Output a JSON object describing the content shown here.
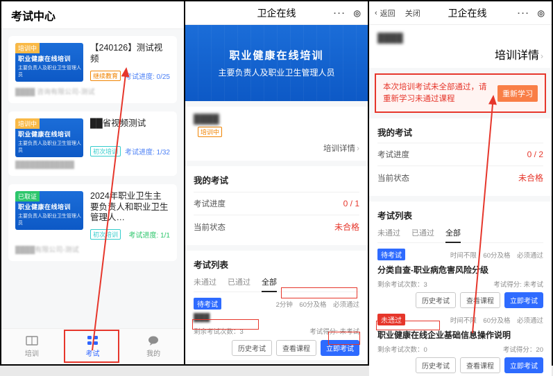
{
  "pane1": {
    "header_title": "考试中心",
    "cards": [
      {
        "badge": "培训中",
        "thumb_line1": "职业健康在线培训",
        "thumb_line2": "主要负责人及职业卫生管理人员",
        "title": "【240126】测试视频",
        "tag": "继续教育",
        "tag_style": "orange",
        "progress_label": "考试进度: 0/25",
        "progress_style": "blue",
        "subtitle": "████ 咨询有限公司-测试"
      },
      {
        "badge": "培训中",
        "thumb_line1": "职业健康在线培训",
        "thumb_line2": "主要负责人及职业卫生管理人员",
        "title": "██省视频测试",
        "tag": "初次培训",
        "tag_style": "teal",
        "progress_label": "考试进度: 1/32",
        "progress_style": "blue",
        "subtitle": "████████████"
      },
      {
        "badge": "已取证",
        "thumb_line1": "职业健康在线培训",
        "thumb_line2": "主要负责人及职业卫生管理人员",
        "title": "2024年职业卫生主要负责人和职业卫生管理人…",
        "tag": "初次培训",
        "tag_style": "teal",
        "progress_label": "考试进度: 1/1",
        "progress_style": "green",
        "subtitle": "████有限公司-测试"
      }
    ],
    "tabs": [
      {
        "label": "培训"
      },
      {
        "label": "考试"
      },
      {
        "label": "我的"
      }
    ]
  },
  "pane2": {
    "title": "卫企在线",
    "banner_t1": "职业健康在线培训",
    "banner_t2": "主要负责人及职业卫生管理人员",
    "org_name": "████",
    "training_status": "培训中",
    "detail_label": "培训详情",
    "myexam_title": "我的考试",
    "progress_label": "考试进度",
    "progress_value": "0 / 1",
    "status_label": "当前状态",
    "status_value": "未合格",
    "list_title": "考试列表",
    "list_tabs": [
      "未通过",
      "已通过",
      "全部"
    ],
    "row1": {
      "chip": "待考试",
      "metas": [
        "2分钟",
        "60分及格",
        "必须通过"
      ],
      "name": "███",
      "remain_label": "剩余考试次数：3",
      "score_label": "考试得分: 未考试",
      "btn_hist": "历史考试",
      "btn_course": "查看课程",
      "btn_start": "立即考试"
    }
  },
  "pane3": {
    "title": "卫企在线",
    "back_label": "返回",
    "close_label": "关闭",
    "org_name": "████",
    "detail_label": "培训详情",
    "alert_text": "本次培训考试未全部通过，请重新学习未通过课程",
    "restudy_btn": "重新学习",
    "myexam_title": "我的考试",
    "progress_label": "考试进度",
    "progress_value": "0 / 2",
    "status_label": "当前状态",
    "status_value": "未合格",
    "list_title": "考试列表",
    "list_tabs": [
      "未通过",
      "已通过",
      "全部"
    ],
    "rows": [
      {
        "chip": "待考试",
        "chip_style": "blue",
        "metas": [
          "时间不限",
          "60分及格",
          "必须通过"
        ],
        "name": "分类自查-职业病危害风险分级",
        "remain_label": "剩余考试次数：3",
        "score_label": "考试得分: 未考试",
        "btn_hist": "历史考试",
        "btn_course": "查看课程",
        "btn_start": "立即考试"
      },
      {
        "chip": "未通过",
        "chip_style": "red",
        "metas": [
          "时间不限",
          "60分及格",
          "必须通过"
        ],
        "name": "职业健康在线企业基础信息操作说明",
        "remain_label": "剩余考试次数：0",
        "score_label": "考试得分：20",
        "btn_hist": "历史考试",
        "btn_course": "查看课程",
        "btn_start": "立即考试"
      }
    ]
  }
}
